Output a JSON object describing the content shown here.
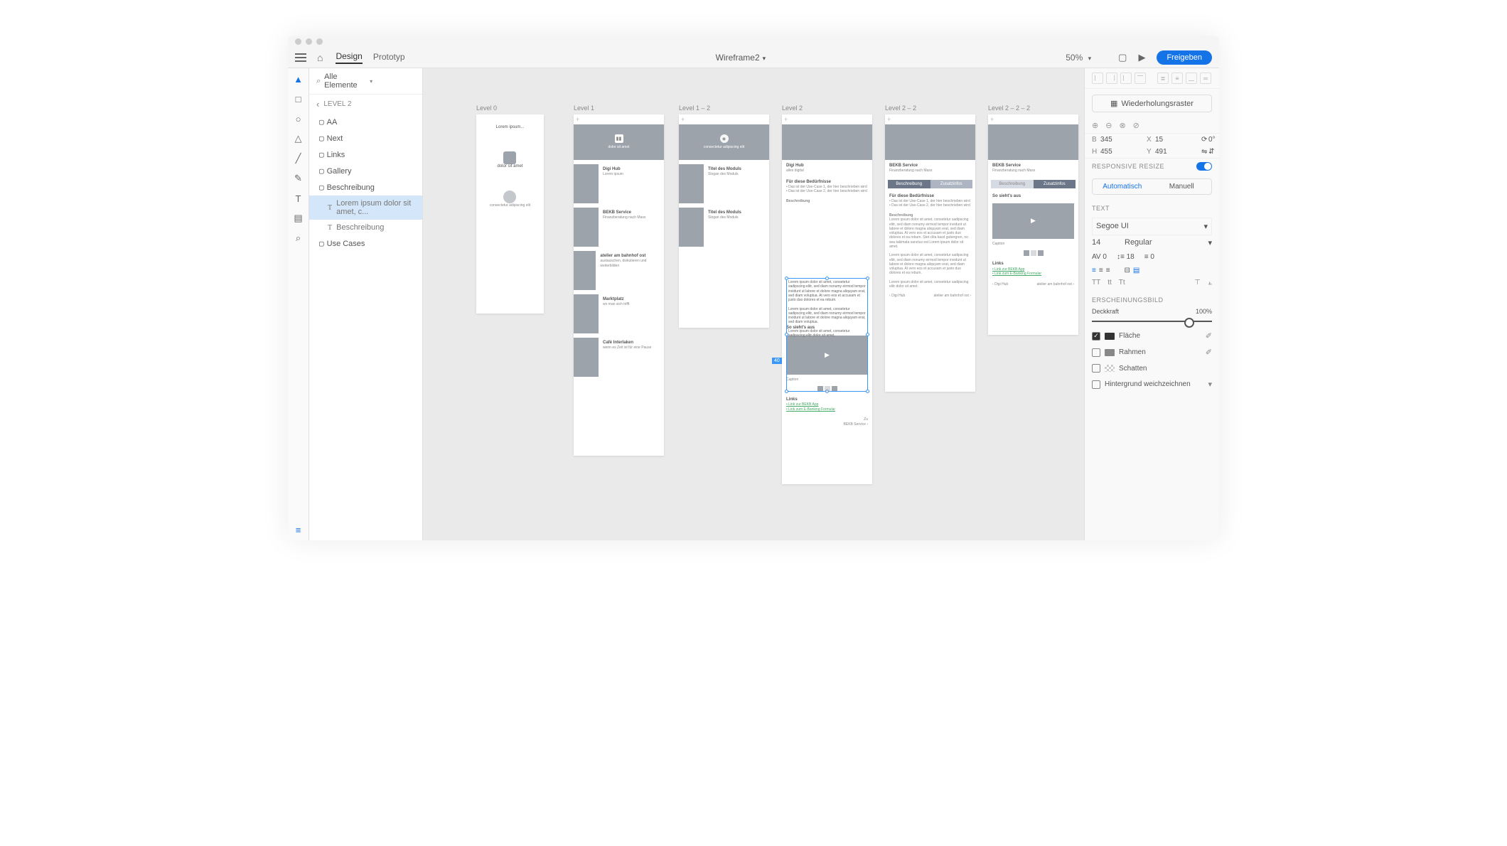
{
  "topbar": {
    "tab1": "Design",
    "tab2": "Prototyp",
    "title": "Wireframe2",
    "zoom": "50%",
    "share": "Freigeben"
  },
  "search": {
    "placeholder": "Alle Elemente"
  },
  "breadcrumb": "LEVEL 2",
  "layers": [
    "AA",
    "Next",
    "Links",
    "Gallery",
    "Beschreibung",
    "Lorem ipsum dolor sit amet, c...",
    "Beschreibung",
    "Use Cases"
  ],
  "artboards": {
    "l0": {
      "label": "Level 0",
      "t1": "Lorem ipsum...",
      "t2": "dolor sit amet",
      "t3": "consectetur adipiscing elit"
    },
    "l1": {
      "label": "Level 1",
      "sub": "dolor sit amet",
      "items": [
        {
          "t": "Digi Hub",
          "s": "Lorem ipsum"
        },
        {
          "t": "BEKB Service",
          "s": "Finanzberatung nach Mass"
        },
        {
          "t": "atelier am bahnhof ost",
          "s": "austauschen, diskutieren und weiterbilden"
        },
        {
          "t": "Marktplatz",
          "s": "wo man sich trifft"
        },
        {
          "t": "Café Interlaken",
          "s": "wenn es Zeit ist für eine Pause"
        }
      ]
    },
    "l12": {
      "label": "Level 1 – 2",
      "sub": "consectetur adipiscing elit",
      "i1": "Titel des Moduls",
      "s1": "Slogan des Moduls",
      "i2": "Titel des Moduls",
      "s2": "Slogan des Moduls"
    },
    "l2": {
      "label": "Level 2",
      "title": "Digi Hub",
      "tag": "alles digital",
      "h1": "Für diese Bedürfnisse",
      "b1": "Das ist der Use-Case 1, der hier beschrieben wird",
      "b2": "Das ist der Use-Case 2, der hier beschrieben wird",
      "desc": "Beschreibung",
      "so": "So sieht's aus",
      "cap": "Caption",
      "links": "Links",
      "lk1": "Link zur BEKB App",
      "lk2": "Link zum E-Banking Formular",
      "next": "BEKB Service",
      "zu": "Zu"
    },
    "l22": {
      "label": "Level 2 – 2",
      "title": "BEKB Service",
      "tag": "Finanzberatung nach Mass",
      "tab1": "Beschreibung",
      "tab2": "Zusatzinfos",
      "prev": "Digi Hub",
      "next": "atelier am bahnhof ost"
    },
    "l222": {
      "label": "Level 2 – 2 – 2",
      "title": "BEKB Service",
      "tag": "Finanzberatung nach Mass",
      "tab1": "Beschreibung",
      "tab2": "Zusatzinfos",
      "so": "So sieht's aus",
      "cap": "Caption",
      "links": "Links",
      "lk1": "Link zur BEKB App",
      "lk2": "Link zum E-Banking Formular",
      "prev": "Digi Hub",
      "next": "atelier am bahnhof ost"
    }
  },
  "sel": {
    "badge": "40"
  },
  "right": {
    "repeat": "Wiederholungsraster",
    "w": "345",
    "x": "15",
    "rot": "0°",
    "h": "455",
    "y": "491",
    "resp": "RESPONSIVE RESIZE",
    "auto": "Automatisch",
    "man": "Manuell",
    "text": "TEXT",
    "font": "Segoe UI",
    "size": "14",
    "weight": "Regular",
    "av": "0",
    "lh": "18",
    "ps": "0",
    "appear": "ERSCHEINUNGSBILD",
    "opac": "Deckkraft",
    "opacv": "100%",
    "fill": "Fläche",
    "border": "Rahmen",
    "shadow": "Schatten",
    "blur": "Hintergrund weichzeichnen"
  }
}
